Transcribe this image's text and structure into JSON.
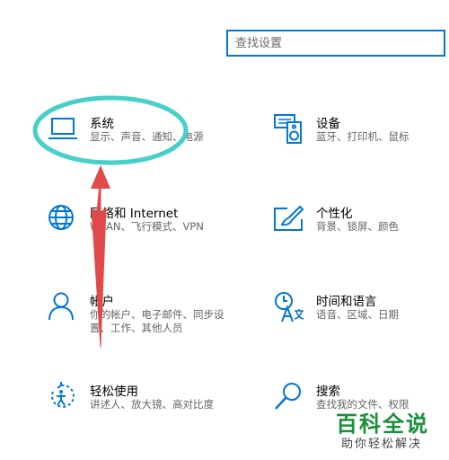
{
  "search": {
    "placeholder": "查找设置",
    "value": ""
  },
  "accent_color": "#0078d7",
  "annotation_color": "#46d0c8",
  "arrow_color": "#e04a4a",
  "categories": [
    {
      "title": "系统",
      "desc": "显示、声音、通知、电源",
      "icon": "laptop-icon"
    },
    {
      "title": "设备",
      "desc": "蓝牙、打印机、鼠标",
      "icon": "keyboard-speaker-icon"
    },
    {
      "title": "网络和 Internet",
      "desc": "WLAN、飞行模式、VPN",
      "icon": "globe-icon"
    },
    {
      "title": "个性化",
      "desc": "背景、锁屏、颜色",
      "icon": "paint-icon"
    },
    {
      "title": "帐户",
      "desc": "你的帐户、电子邮件、同步设\n置、工作、其他人员",
      "icon": "user-icon"
    },
    {
      "title": "时间和语言",
      "desc": "语音、区域、日期",
      "icon": "time-language-icon"
    },
    {
      "title": "轻松使用",
      "desc": "讲述人、放大镜、高对比度",
      "icon": "ease-of-access-icon"
    },
    {
      "title": "搜索",
      "desc": "查找我的文件、权限",
      "icon": "search-icon"
    }
  ],
  "watermark": {
    "main": "百科全说",
    "sub": "助你轻松解决"
  }
}
